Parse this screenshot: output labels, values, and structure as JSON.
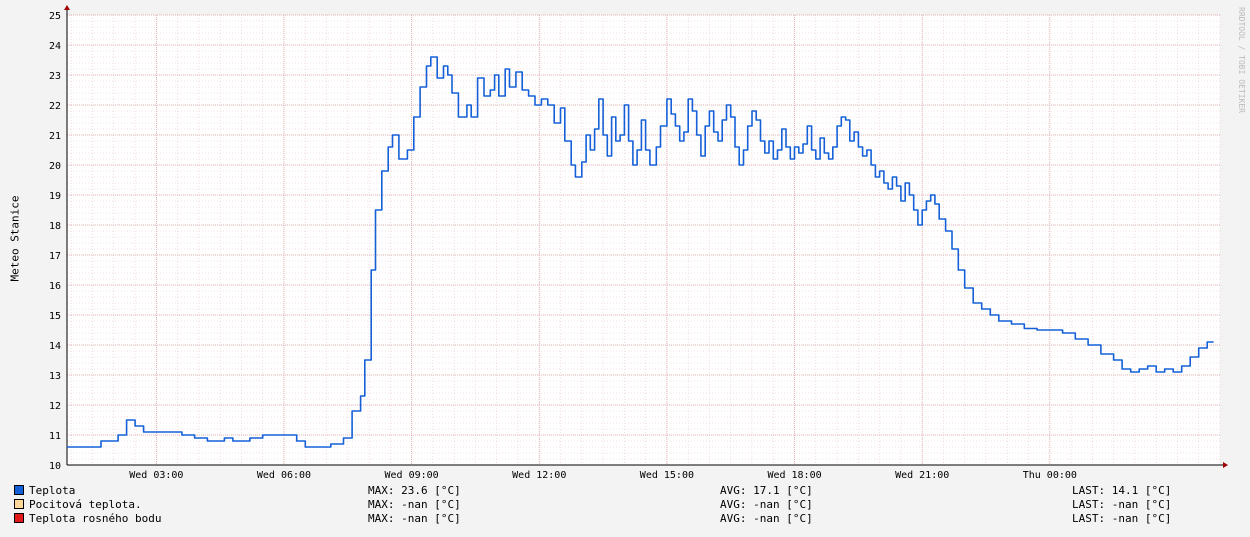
{
  "chart_data": {
    "type": "line",
    "ylabel": "Meteo Stanice",
    "watermark": "RRDTOOL / TOBI OETIKER",
    "ylim": [
      10,
      25
    ],
    "y_ticks": [
      "10",
      "11",
      "12",
      "13",
      "14",
      "15",
      "16",
      "17",
      "18",
      "19",
      "20",
      "21",
      "22",
      "23",
      "24",
      "25"
    ],
    "x_ticks": [
      "Wed 03:00",
      "Wed 06:00",
      "Wed 09:00",
      "Wed 12:00",
      "Wed 15:00",
      "Wed 18:00",
      "Wed 21:00",
      "Thu 00:00"
    ],
    "x_range_hours": [
      0.9,
      25
    ],
    "series": [
      {
        "name": "Teplota",
        "color": "#1560d8",
        "points": [
          [
            0.9,
            10.6
          ],
          [
            1.3,
            10.6
          ],
          [
            1.7,
            10.8
          ],
          [
            2.1,
            11.0
          ],
          [
            2.3,
            11.5
          ],
          [
            2.5,
            11.3
          ],
          [
            2.7,
            11.1
          ],
          [
            3.0,
            11.1
          ],
          [
            3.3,
            11.1
          ],
          [
            3.6,
            11.0
          ],
          [
            3.9,
            10.9
          ],
          [
            4.2,
            10.8
          ],
          [
            4.6,
            10.9
          ],
          [
            4.8,
            10.8
          ],
          [
            5.2,
            10.9
          ],
          [
            5.5,
            11.0
          ],
          [
            5.8,
            11.0
          ],
          [
            6.0,
            11.0
          ],
          [
            6.3,
            10.8
          ],
          [
            6.5,
            10.6
          ],
          [
            6.8,
            10.6
          ],
          [
            7.1,
            10.7
          ],
          [
            7.4,
            10.9
          ],
          [
            7.6,
            11.8
          ],
          [
            7.8,
            12.3
          ],
          [
            7.9,
            13.5
          ],
          [
            8.05,
            16.5
          ],
          [
            8.15,
            18.5
          ],
          [
            8.3,
            19.8
          ],
          [
            8.45,
            20.6
          ],
          [
            8.55,
            21.0
          ],
          [
            8.7,
            20.2
          ],
          [
            8.9,
            20.5
          ],
          [
            9.05,
            21.6
          ],
          [
            9.2,
            22.6
          ],
          [
            9.35,
            23.3
          ],
          [
            9.45,
            23.6
          ],
          [
            9.6,
            22.9
          ],
          [
            9.75,
            23.3
          ],
          [
            9.85,
            23.0
          ],
          [
            9.95,
            22.4
          ],
          [
            10.1,
            21.6
          ],
          [
            10.3,
            22.0
          ],
          [
            10.4,
            21.6
          ],
          [
            10.55,
            22.9
          ],
          [
            10.7,
            22.3
          ],
          [
            10.85,
            22.5
          ],
          [
            10.95,
            23.0
          ],
          [
            11.05,
            22.3
          ],
          [
            11.2,
            23.2
          ],
          [
            11.3,
            22.6
          ],
          [
            11.45,
            23.1
          ],
          [
            11.6,
            22.5
          ],
          [
            11.75,
            22.3
          ],
          [
            11.9,
            22.0
          ],
          [
            12.05,
            22.2
          ],
          [
            12.2,
            22.0
          ],
          [
            12.35,
            21.4
          ],
          [
            12.5,
            21.9
          ],
          [
            12.6,
            20.8
          ],
          [
            12.75,
            20.0
          ],
          [
            12.85,
            19.6
          ],
          [
            13.0,
            20.1
          ],
          [
            13.1,
            21.0
          ],
          [
            13.2,
            20.5
          ],
          [
            13.3,
            21.2
          ],
          [
            13.4,
            22.2
          ],
          [
            13.5,
            21.0
          ],
          [
            13.6,
            20.3
          ],
          [
            13.7,
            21.6
          ],
          [
            13.8,
            20.8
          ],
          [
            13.9,
            21.0
          ],
          [
            14.0,
            22.0
          ],
          [
            14.1,
            20.8
          ],
          [
            14.2,
            20.0
          ],
          [
            14.3,
            20.5
          ],
          [
            14.4,
            21.5
          ],
          [
            14.5,
            20.5
          ],
          [
            14.6,
            20.0
          ],
          [
            14.75,
            20.6
          ],
          [
            14.85,
            21.3
          ],
          [
            15.0,
            22.2
          ],
          [
            15.1,
            21.7
          ],
          [
            15.2,
            21.3
          ],
          [
            15.3,
            20.8
          ],
          [
            15.4,
            21.1
          ],
          [
            15.5,
            22.2
          ],
          [
            15.6,
            21.8
          ],
          [
            15.7,
            21.0
          ],
          [
            15.8,
            20.3
          ],
          [
            15.9,
            21.3
          ],
          [
            16.0,
            21.8
          ],
          [
            16.1,
            21.1
          ],
          [
            16.2,
            20.8
          ],
          [
            16.3,
            21.5
          ],
          [
            16.4,
            22.0
          ],
          [
            16.5,
            21.6
          ],
          [
            16.6,
            20.6
          ],
          [
            16.7,
            20.0
          ],
          [
            16.8,
            20.5
          ],
          [
            16.9,
            21.3
          ],
          [
            17.0,
            21.8
          ],
          [
            17.1,
            21.5
          ],
          [
            17.2,
            20.8
          ],
          [
            17.3,
            20.4
          ],
          [
            17.4,
            20.8
          ],
          [
            17.5,
            20.2
          ],
          [
            17.6,
            20.5
          ],
          [
            17.7,
            21.2
          ],
          [
            17.8,
            20.6
          ],
          [
            17.9,
            20.2
          ],
          [
            18.0,
            20.6
          ],
          [
            18.1,
            20.4
          ],
          [
            18.2,
            20.7
          ],
          [
            18.3,
            21.3
          ],
          [
            18.4,
            20.5
          ],
          [
            18.5,
            20.2
          ],
          [
            18.6,
            20.9
          ],
          [
            18.7,
            20.4
          ],
          [
            18.8,
            20.2
          ],
          [
            18.9,
            20.6
          ],
          [
            19.0,
            21.3
          ],
          [
            19.1,
            21.6
          ],
          [
            19.2,
            21.5
          ],
          [
            19.3,
            20.8
          ],
          [
            19.4,
            21.1
          ],
          [
            19.5,
            20.6
          ],
          [
            19.6,
            20.3
          ],
          [
            19.7,
            20.5
          ],
          [
            19.8,
            20.0
          ],
          [
            19.9,
            19.6
          ],
          [
            20.0,
            19.8
          ],
          [
            20.1,
            19.4
          ],
          [
            20.2,
            19.2
          ],
          [
            20.3,
            19.6
          ],
          [
            20.4,
            19.3
          ],
          [
            20.5,
            18.8
          ],
          [
            20.6,
            19.4
          ],
          [
            20.7,
            19.0
          ],
          [
            20.8,
            18.5
          ],
          [
            20.9,
            18.0
          ],
          [
            21.0,
            18.5
          ],
          [
            21.1,
            18.8
          ],
          [
            21.2,
            19.0
          ],
          [
            21.3,
            18.7
          ],
          [
            21.4,
            18.2
          ],
          [
            21.55,
            17.8
          ],
          [
            21.7,
            17.2
          ],
          [
            21.85,
            16.5
          ],
          [
            22.0,
            15.9
          ],
          [
            22.2,
            15.4
          ],
          [
            22.4,
            15.2
          ],
          [
            22.6,
            15.0
          ],
          [
            22.8,
            14.8
          ],
          [
            23.1,
            14.7
          ],
          [
            23.4,
            14.55
          ],
          [
            23.7,
            14.5
          ],
          [
            24.0,
            14.5
          ],
          [
            24.3,
            14.4
          ],
          [
            24.6,
            14.2
          ],
          [
            24.9,
            14.0
          ],
          [
            25.2,
            13.7
          ],
          [
            25.5,
            13.5
          ],
          [
            25.7,
            13.2
          ],
          [
            25.9,
            13.1
          ],
          [
            26.1,
            13.2
          ],
          [
            26.3,
            13.3
          ],
          [
            26.5,
            13.1
          ],
          [
            26.7,
            13.2
          ],
          [
            26.9,
            13.1
          ],
          [
            27.1,
            13.3
          ],
          [
            27.3,
            13.6
          ],
          [
            27.5,
            13.9
          ],
          [
            27.7,
            14.1
          ],
          [
            27.85,
            14.1
          ]
        ]
      },
      {
        "name": "Pocitová teplota.",
        "color": "#ffd89a",
        "points": []
      },
      {
        "name": "Teplota rosného bodu",
        "color": "#e11a1a",
        "points": []
      }
    ]
  },
  "legend": [
    {
      "name": "Teplota",
      "max": "MAX: 23.6 [°C]",
      "avg": "AVG: 17.1 [°C]",
      "last": "LAST: 14.1 [°C]"
    },
    {
      "name": "Pocitová teplota.",
      "max": "MAX: -nan [°C]",
      "avg": "AVG: -nan [°C]",
      "last": "LAST: -nan [°C]"
    },
    {
      "name": "Teplota rosného bodu",
      "max": "MAX: -nan [°C]",
      "avg": "AVG: -nan [°C]",
      "last": "LAST: -nan [°C]"
    }
  ]
}
